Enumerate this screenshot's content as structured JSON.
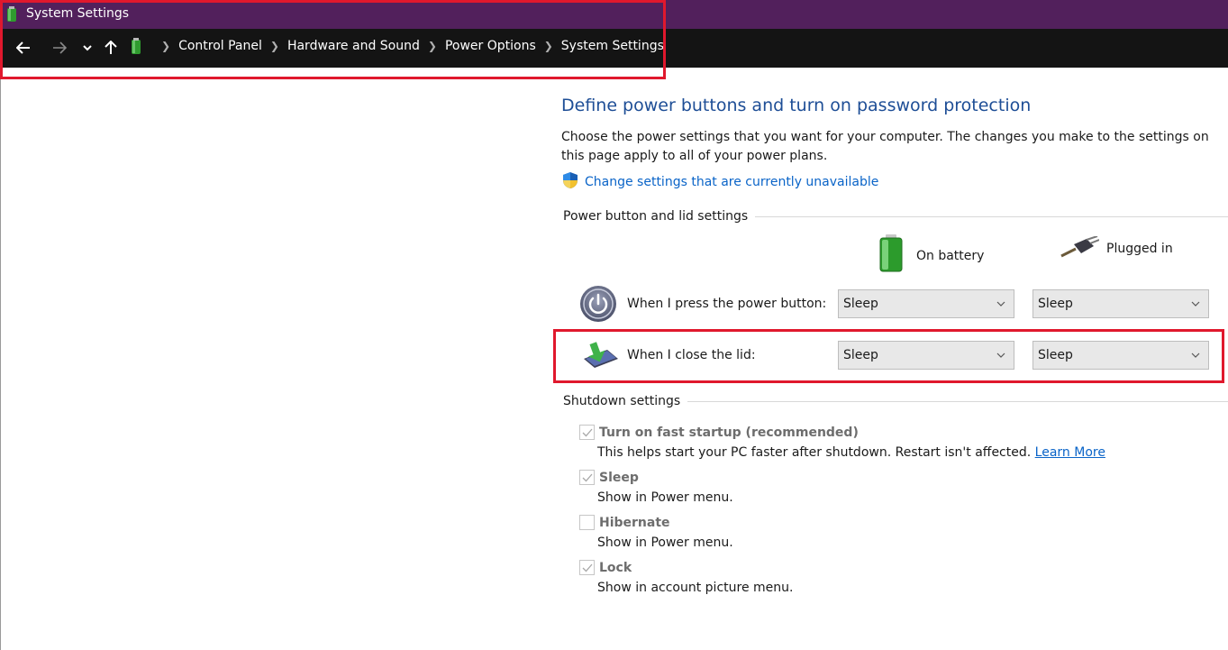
{
  "window": {
    "title": "System Settings"
  },
  "navigation": {
    "back_icon": "back-arrow-icon",
    "forward_icon": "forward-arrow-icon",
    "recent_icon": "chevron-down-icon",
    "up_icon": "up-arrow-icon",
    "breadcrumbs": [
      "Control Panel",
      "Hardware and Sound",
      "Power Options",
      "System Settings"
    ]
  },
  "main": {
    "heading": "Define power buttons and turn on password protection",
    "description": "Choose the power settings that you want for your computer. The changes you make to the settings on this page apply to all of your power plans.",
    "change_settings_link": "Change settings that are currently unavailable",
    "power_section": {
      "title": "Power button and lid settings",
      "columns": {
        "battery": "On battery",
        "plugged": "Plugged in"
      },
      "rows": [
        {
          "label": "When I press the power button:",
          "battery_value": "Sleep",
          "plugged_value": "Sleep",
          "icon": "power-button-icon"
        },
        {
          "label": "When I close the lid:",
          "battery_value": "Sleep",
          "plugged_value": "Sleep",
          "icon": "laptop-lid-icon"
        }
      ]
    },
    "shutdown_section": {
      "title": "Shutdown settings",
      "options": [
        {
          "label": "Turn on fast startup (recommended)",
          "description": "This helps start your PC faster after shutdown. Restart isn't affected.",
          "link": "Learn More",
          "checked": true
        },
        {
          "label": "Sleep",
          "description": "Show in Power menu.",
          "checked": true
        },
        {
          "label": "Hibernate",
          "description": "Show in Power menu.",
          "checked": false
        },
        {
          "label": "Lock",
          "description": "Show in account picture menu.",
          "checked": true
        }
      ]
    }
  },
  "colors": {
    "titlebar": "#52205c",
    "addressbar": "#141414",
    "heading": "#1e4e96",
    "link": "#0a64c8",
    "highlight": "#e0182d"
  }
}
